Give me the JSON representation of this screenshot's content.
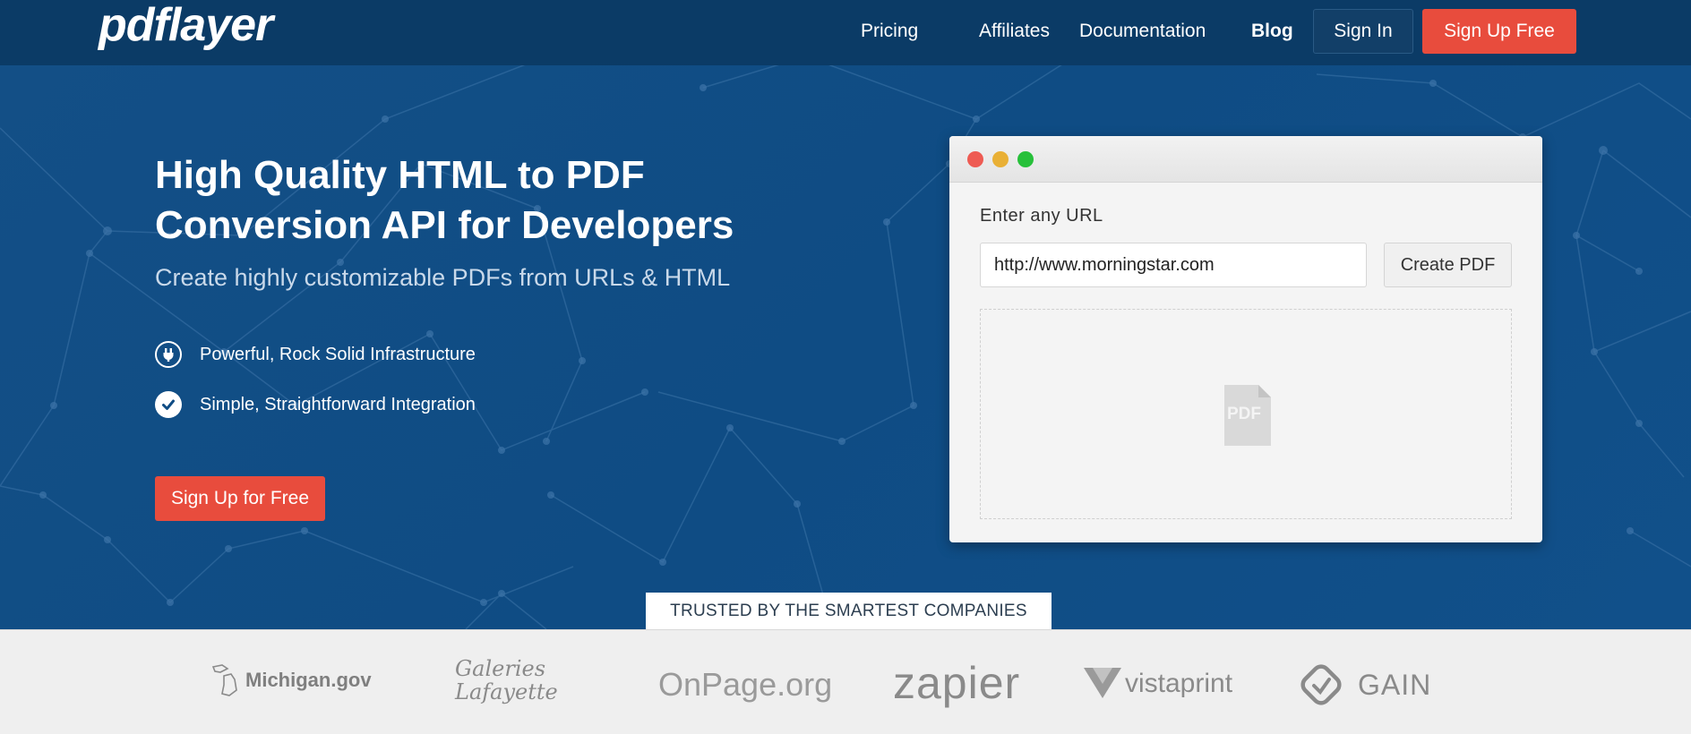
{
  "nav": {
    "logo": "pdflayer",
    "links": [
      "Pricing",
      "Affiliates",
      "Documentation",
      "Blog"
    ],
    "sign_in": "Sign In",
    "sign_up": "Sign Up Free"
  },
  "hero": {
    "headline_line1": "High Quality HTML to PDF",
    "headline_line2": "Conversion API for Developers",
    "subline": "Create highly customizable PDFs from URLs & HTML",
    "features": [
      {
        "text": "Powerful, Rock Solid Infrastructure",
        "icon": "plug-icon"
      },
      {
        "text": "Simple, Straightforward Integration",
        "icon": "check-circle-icon"
      }
    ],
    "cta": "Sign Up for Free"
  },
  "demo": {
    "label": "Enter any URL",
    "url_value": "http://www.morningstar.com",
    "create_button": "Create PDF",
    "pdf_icon_label": "PDF"
  },
  "trusted": {
    "heading": "TRUSTED BY THE SMARTEST COMPANIES",
    "logos": [
      "Michigan.gov",
      "Galeries Lafayette",
      "OnPage.org",
      "zapier",
      "vistaprint",
      "GAIN"
    ]
  },
  "colors": {
    "nav_bg": "#0b3b66",
    "hero_bg": "#0f4c84",
    "accent_red": "#e84c3d",
    "dot_red": "#ee5b53",
    "dot_yellow": "#e9b036",
    "dot_green": "#27c03a"
  }
}
